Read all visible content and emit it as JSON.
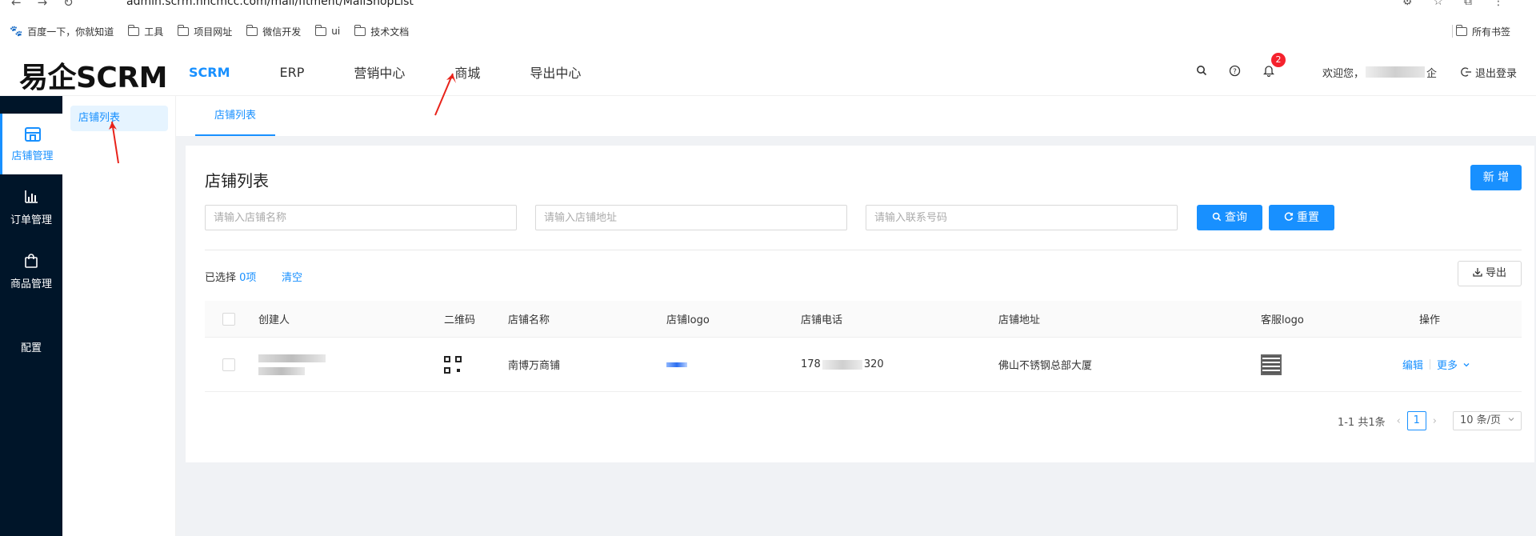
{
  "browser": {
    "url": "admin.scrm.hncmcc.com/mall/fitment/MallShopList",
    "bookmarks": [
      "百度一下，你就知道",
      "工具",
      "项目网址",
      "微信开发",
      "ui",
      "技术文档"
    ],
    "all_bookmarks": "所有书签"
  },
  "header": {
    "logo": "易企SCRM",
    "nav": [
      "SCRM",
      "ERP",
      "营销中心",
      "商城",
      "导出中心"
    ],
    "notification_count": "2",
    "welcome": "欢迎您，",
    "welcome_suffix": "企",
    "logout": "退出登录"
  },
  "sidebar": {
    "items": [
      "店铺管理",
      "订单管理",
      "商品管理",
      "配置"
    ],
    "sub_item": "店铺列表"
  },
  "tabs": [
    "店铺列表"
  ],
  "page": {
    "title": "店铺列表",
    "new_button": "新 增",
    "search": {
      "shop_name_placeholder": "请输入店铺名称",
      "shop_address_placeholder": "请输入店铺地址",
      "contact_phone_placeholder": "请输入联系号码",
      "query_button": "查询",
      "reset_button": "重置"
    },
    "selected_prefix": "已选择",
    "selected_count": "0项",
    "clear": "清空",
    "export_button": "导出"
  },
  "table": {
    "columns": [
      "创建人",
      "二维码",
      "店铺名称",
      "店铺logo",
      "店铺电话",
      "店铺地址",
      "客服logo",
      "操作"
    ],
    "rows": [
      {
        "shop_name": "南博万商铺",
        "phone_prefix": "178",
        "phone_suffix": "320",
        "address": "佛山不锈钢总部大厦",
        "edit": "编辑",
        "more": "更多"
      }
    ]
  },
  "pagination": {
    "summary": "1-1 共1条",
    "current": "1",
    "page_size": "10 条/页"
  },
  "colors": {
    "primary": "#1890ff",
    "sidebar": "#001529",
    "badge": "#f5222d",
    "annotation": "#e8231a"
  }
}
